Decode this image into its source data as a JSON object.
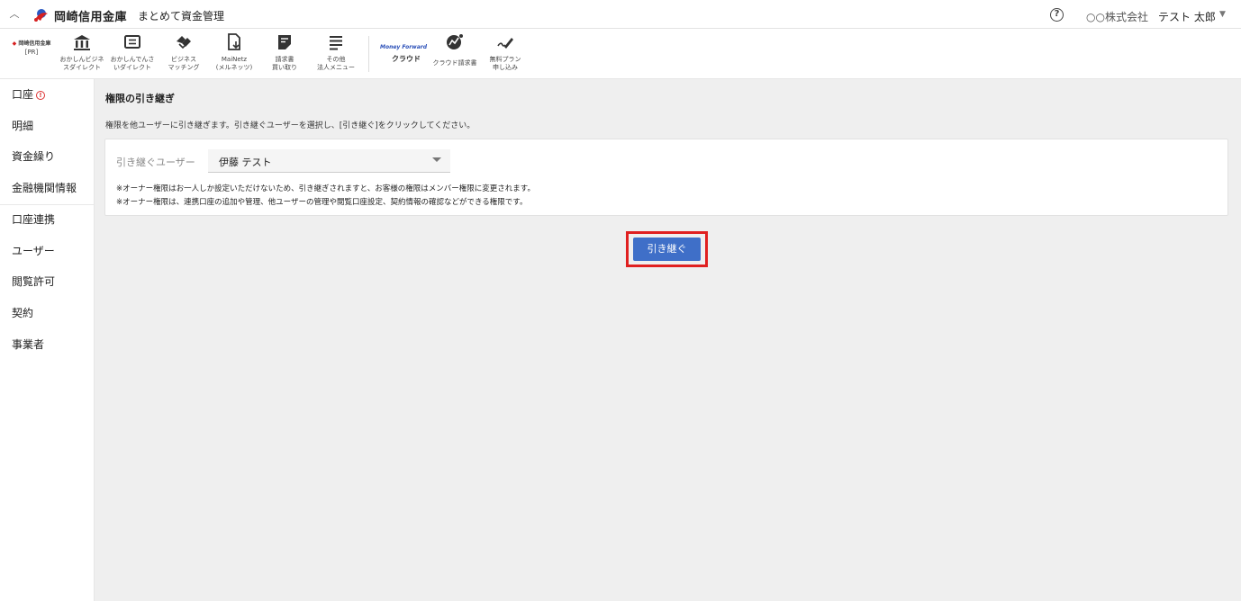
{
  "header": {
    "bank_name": "岡崎信用金庫",
    "app_name": "まとめて資金管理",
    "company": "○○株式会社",
    "user_name": "テスト 太郎",
    "help_icon": "question-circle-icon",
    "brand_color": "#d62020"
  },
  "toolbar": {
    "pr_logo_text": "岡崎信用金庫",
    "pr_label": "[PR]",
    "items": [
      {
        "line1": "おかしんビジネ",
        "line2": "スダイレクト",
        "icon": "bank-icon"
      },
      {
        "line1": "おかしんでんさ",
        "line2": "いダイレクト",
        "icon": "document-list-icon"
      },
      {
        "line1": "ビジネス",
        "line2": "マッチング",
        "icon": "handshake-icon"
      },
      {
        "line1": "MaiNetz",
        "line2": "(メルネッツ)",
        "icon": "file-download-icon"
      },
      {
        "line1": "請求書",
        "line2": "買い取り",
        "icon": "invoice-icon"
      },
      {
        "line1": "その他",
        "line2": "法人メニュー",
        "icon": "menu-lines-icon"
      }
    ],
    "mf_logo": "Money Forward",
    "mf_cloud": "クラウド",
    "mf_invoice": "クラウド請求書",
    "free_plan_line1": "無料プラン",
    "free_plan_line2": "申し込み"
  },
  "sidebar": {
    "items": [
      {
        "label": "口座",
        "alert": true
      },
      {
        "label": "明細"
      },
      {
        "label": "資金繰り"
      },
      {
        "label": "金融機関情報"
      },
      {
        "label": "口座連携"
      },
      {
        "label": "ユーザー"
      },
      {
        "label": "閲覧許可"
      },
      {
        "label": "契約"
      },
      {
        "label": "事業者"
      }
    ]
  },
  "main": {
    "title": "権限の引き継ぎ",
    "description": "権限を他ユーザーに引き継ぎます。引き継ぐユーザーを選択し、[引き継ぐ]をクリックしてください。",
    "field_label": "引き継ぐユーザー",
    "selected_user": "伊藤 テスト",
    "note1": "※オーナー権限はお一人しか設定いただけないため、引き継ぎされますと、お客様の権限はメンバー権限に変更されます。",
    "note2": "※オーナー権限は、連携口座の追加や管理、他ユーザーの管理や閲覧口座設定、契約情報の確認などができる権限です。",
    "submit_label": "引き継ぐ",
    "button_color": "#3f6fc8",
    "highlight_color": "#e02020"
  }
}
